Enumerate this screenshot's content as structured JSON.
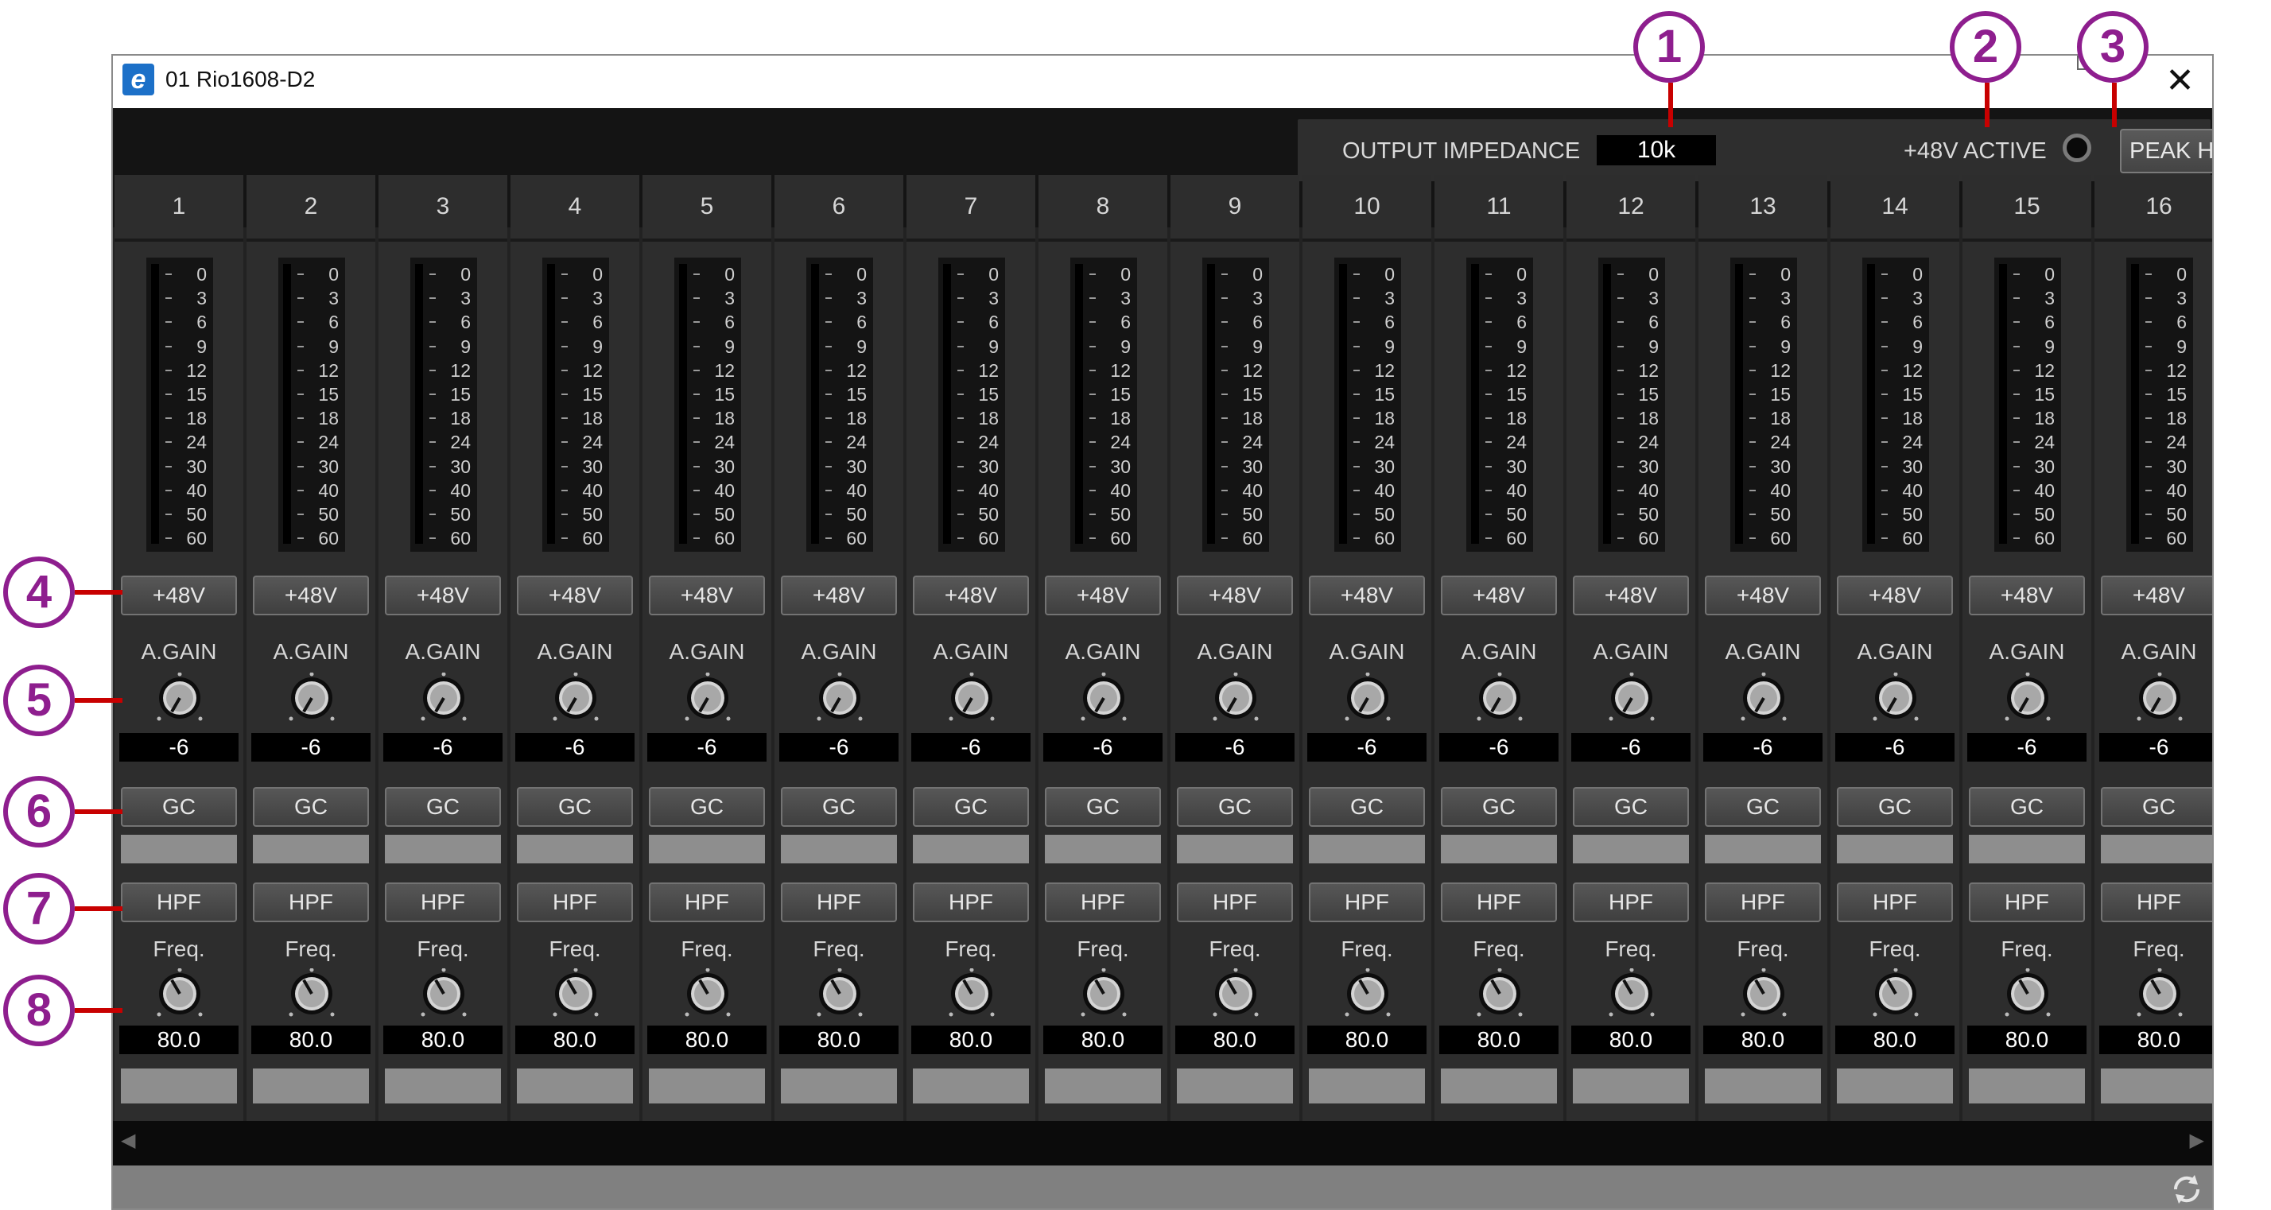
{
  "window": {
    "title": "01 Rio1608-D2",
    "close_label": "✕"
  },
  "toolbar": {
    "impedance_label": "OUTPUT IMPEDANCE",
    "impedance_value": "10k",
    "phantom_label": "+48V ACTIVE",
    "peak_hold_label": "PEAK HOLD"
  },
  "meter_scale": [
    "0",
    "3",
    "6",
    "9",
    "12",
    "15",
    "18",
    "24",
    "30",
    "40",
    "50",
    "60"
  ],
  "channel_labels": {
    "phantom": "+48V",
    "gain": "A.GAIN",
    "gc": "GC",
    "hpf": "HPF",
    "freq": "Freq."
  },
  "channels": [
    {
      "number": "1",
      "gain": "-6",
      "freq": "80.0"
    },
    {
      "number": "2",
      "gain": "-6",
      "freq": "80.0"
    },
    {
      "number": "3",
      "gain": "-6",
      "freq": "80.0"
    },
    {
      "number": "4",
      "gain": "-6",
      "freq": "80.0"
    },
    {
      "number": "5",
      "gain": "-6",
      "freq": "80.0"
    },
    {
      "number": "6",
      "gain": "-6",
      "freq": "80.0"
    },
    {
      "number": "7",
      "gain": "-6",
      "freq": "80.0"
    },
    {
      "number": "8",
      "gain": "-6",
      "freq": "80.0"
    },
    {
      "number": "9",
      "gain": "-6",
      "freq": "80.0"
    },
    {
      "number": "10",
      "gain": "-6",
      "freq": "80.0"
    },
    {
      "number": "11",
      "gain": "-6",
      "freq": "80.0"
    },
    {
      "number": "12",
      "gain": "-6",
      "freq": "80.0"
    },
    {
      "number": "13",
      "gain": "-6",
      "freq": "80.0"
    },
    {
      "number": "14",
      "gain": "-6",
      "freq": "80.0"
    },
    {
      "number": "15",
      "gain": "-6",
      "freq": "80.0"
    },
    {
      "number": "16",
      "gain": "-6",
      "freq": "80.0"
    }
  ],
  "callouts": [
    "1",
    "2",
    "3",
    "4",
    "5",
    "6",
    "7",
    "8"
  ],
  "scroll": {
    "left": "◀",
    "right": "▶"
  }
}
